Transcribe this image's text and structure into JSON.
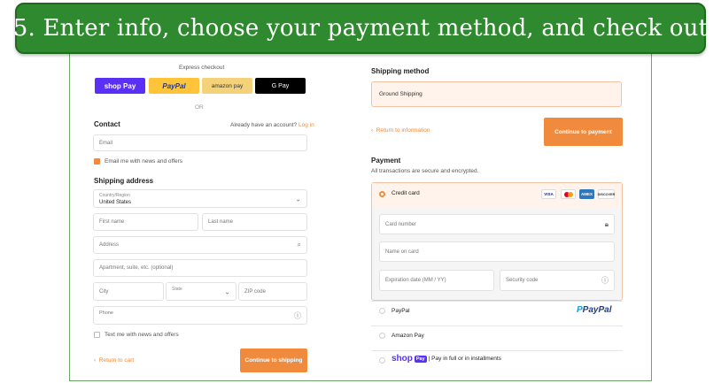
{
  "banner": {
    "text": "5. Enter info, choose your payment method, and check out"
  },
  "express": {
    "title": "Express checkout",
    "shop_pay": "shop Pay",
    "paypal": "PayPal",
    "amazon_pay": "amazon pay",
    "gpay": "G Pay",
    "or": "OR"
  },
  "contact": {
    "title": "Contact",
    "account_prompt": "Already have an account?",
    "login_link": "Log in",
    "email_placeholder": "Email",
    "email_news": "Email me with news and offers"
  },
  "shipping_address": {
    "title": "Shipping address",
    "country_label": "Country/Region",
    "country_value": "United States",
    "first_name": "First name",
    "last_name": "Last name",
    "address": "Address",
    "apartment": "Apartment, suite, etc. (optional)",
    "city": "City",
    "state": "State",
    "zip": "ZIP code",
    "phone": "Phone",
    "text_news": "Text me with news and offers"
  },
  "left_footer": {
    "return_cart": "Return to cart",
    "continue_shipping": "Continue to shipping"
  },
  "shipping_method": {
    "title": "Shipping method",
    "option": "Ground Shipping",
    "return_info": "Return to information",
    "continue_payment": "Continue to payment"
  },
  "payment": {
    "title": "Payment",
    "subtitle": "All transactions are secure and encrypted.",
    "credit_card": "Credit card",
    "card_badges": [
      "VISA",
      "",
      "AMEX",
      "DISCOVER"
    ],
    "card_number": "Card number",
    "name_on_card": "Name on card",
    "expiration": "Expiration date (MM / YY)",
    "security_code": "Security code",
    "paypal_option": "PayPal",
    "paypal_logo": "PayPal",
    "amazon_option": "Amazon Pay",
    "shop_pay_badge": "Pay",
    "shop_pay_text": "| Pay in full or in installments",
    "shop_word": "shop"
  },
  "colors": {
    "banner_green": "#2f8a2f",
    "accent_orange": "#f08a3c",
    "shop_pay_purple": "#5a31f4",
    "paypal_yellow": "#ffc439",
    "amazon_yellow": "#f3d27a",
    "gpay_black": "#000000",
    "selected_bg": "#fff3ec"
  }
}
